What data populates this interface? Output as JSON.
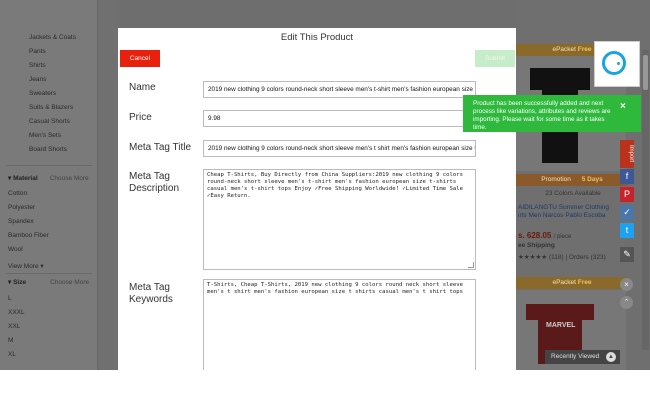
{
  "modal": {
    "title": "Edit This Product",
    "cancel_label": "Cancel",
    "submit_label": "Submit",
    "fields": {
      "name_label": "Name",
      "name_value": "2019 new clothing 9 colors round-neck short sleeve men's t-shirt men's fashion european size t-shirts",
      "price_label": "Price",
      "price_value": "9.98",
      "meta_title_label": "Meta Tag Title",
      "meta_title_value": "2019 new clothing 9 colors round-neck short sleeve men's t shirt men's fashion european size t shirts",
      "meta_desc_label": "Meta Tag Description",
      "meta_desc_value": "Cheap T-Shirts, Buy Directly from China Suppliers:2019 new clothing 9 colors round-neck short sleeve men's t-shirt men's fashion european size t-shirts casual men's t-shirt tops Enjoy ✓Free Shipping Worldwide! ✓Limited Time Sale ✓Easy Return.",
      "meta_keywords_label": "Meta Tag Keywords",
      "meta_keywords_value": "T-Shirts, Cheap T-Shirts, 2019 new clothing 9 colors round neck short sleeve men's t shirt men's fashion european size t shirts casual men's t shirt tops"
    }
  },
  "toast": {
    "message": "Product has been successfully added and next process like variations, attributes and reviews are importing. Please wait for some time as it takes time.",
    "close": "×"
  },
  "sidebar": {
    "categories": [
      "Jackets & Coats",
      "Pants",
      "Shirts",
      "Jeans",
      "Sweaters",
      "Suits & Blazers",
      "Casual Shorts",
      "Men's Sets",
      "Board Shorts"
    ],
    "material_title": "Material",
    "material_more": "Choose More",
    "materials": [
      "Cotton",
      "Polyester",
      "Spandex",
      "Bamboo Fiber",
      "Wool"
    ],
    "view_more": "View More",
    "size_title": "Size",
    "size_more": "Choose More",
    "sizes": [
      "L",
      "XXXL",
      "XXL",
      "M",
      "XL"
    ]
  },
  "right_panel": {
    "epacket_1": "ePacket",
    "free_1": "Free",
    "colors_available": "23 Colors Available",
    "product_title_1": "AIDILANGTU Summer Clothing",
    "product_title_2": "irts Men Narcos Pablo Escoba",
    "price": "s. 628.05",
    "price_unit": "/ piece",
    "shipping": "ee Shipping",
    "rating": "★★★★★ (118) | Orders (323)",
    "promo_left": "Promotion",
    "promo_right": "5 Days",
    "epacket_2": "ePacket",
    "free_2": "Free",
    "brand_text": "MARVEL",
    "recently_viewed": "Recently Viewed"
  },
  "social_side": {
    "tab_label": "Import"
  },
  "colors": {
    "cancel": "#e8200e",
    "submit": "#c6ecc9",
    "toast": "#2eb83c",
    "accent": "#1aa3e0"
  }
}
